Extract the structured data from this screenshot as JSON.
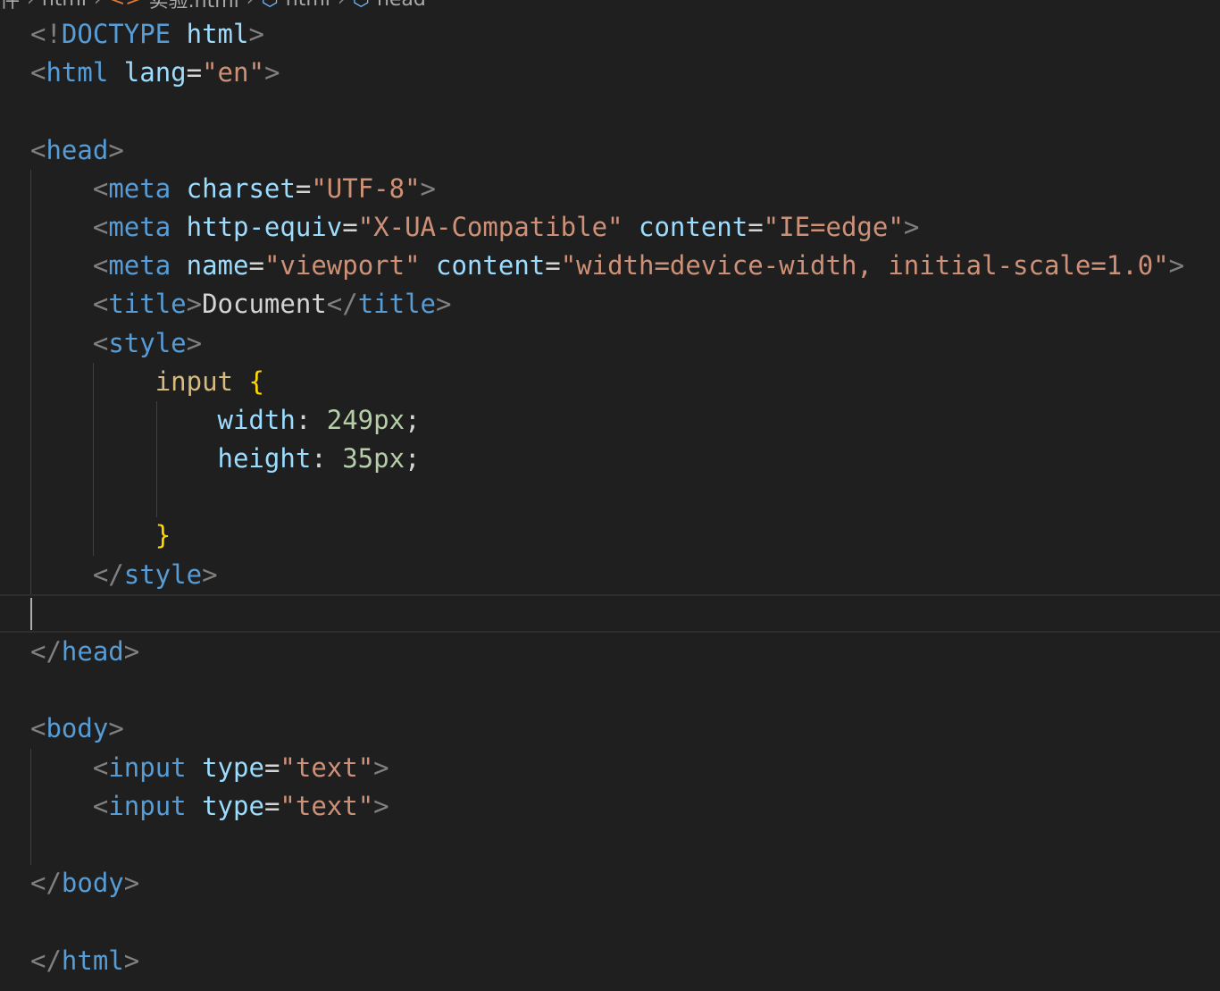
{
  "breadcrumb": [
    "件",
    "html",
    "实验.html",
    "html",
    "head"
  ],
  "editor": {
    "cursor_line": 15,
    "lines": [
      [
        [
          "punc",
          "<!"
        ],
        [
          "tag",
          "DOCTYPE"
        ],
        [
          "text",
          " "
        ],
        [
          "attr",
          "html"
        ],
        [
          "punc",
          ">"
        ]
      ],
      [
        [
          "punc",
          "<"
        ],
        [
          "tag",
          "html"
        ],
        [
          "text",
          " "
        ],
        [
          "attr",
          "lang"
        ],
        [
          "text",
          "="
        ],
        [
          "str",
          "\"en\""
        ],
        [
          "punc",
          ">"
        ]
      ],
      [],
      [
        [
          "punc",
          "<"
        ],
        [
          "tag",
          "head"
        ],
        [
          "punc",
          ">"
        ]
      ],
      [
        [
          "text",
          "    "
        ],
        [
          "punc",
          "<"
        ],
        [
          "tag",
          "meta"
        ],
        [
          "text",
          " "
        ],
        [
          "attr",
          "charset"
        ],
        [
          "text",
          "="
        ],
        [
          "str",
          "\"UTF-8\""
        ],
        [
          "punc",
          ">"
        ]
      ],
      [
        [
          "text",
          "    "
        ],
        [
          "punc",
          "<"
        ],
        [
          "tag",
          "meta"
        ],
        [
          "text",
          " "
        ],
        [
          "attr",
          "http-equiv"
        ],
        [
          "text",
          "="
        ],
        [
          "str",
          "\"X-UA-Compatible\""
        ],
        [
          "text",
          " "
        ],
        [
          "attr",
          "content"
        ],
        [
          "text",
          "="
        ],
        [
          "str",
          "\"IE=edge\""
        ],
        [
          "punc",
          ">"
        ]
      ],
      [
        [
          "text",
          "    "
        ],
        [
          "punc",
          "<"
        ],
        [
          "tag",
          "meta"
        ],
        [
          "text",
          " "
        ],
        [
          "attr",
          "name"
        ],
        [
          "text",
          "="
        ],
        [
          "str",
          "\"viewport\""
        ],
        [
          "text",
          " "
        ],
        [
          "attr",
          "content"
        ],
        [
          "text",
          "="
        ],
        [
          "str",
          "\"width=device-width, initial-scale=1.0\""
        ],
        [
          "punc",
          ">"
        ]
      ],
      [
        [
          "text",
          "    "
        ],
        [
          "punc",
          "<"
        ],
        [
          "tag",
          "title"
        ],
        [
          "punc",
          ">"
        ],
        [
          "text",
          "Document"
        ],
        [
          "punc",
          "</"
        ],
        [
          "tag",
          "title"
        ],
        [
          "punc",
          ">"
        ]
      ],
      [
        [
          "text",
          "    "
        ],
        [
          "punc",
          "<"
        ],
        [
          "tag",
          "style"
        ],
        [
          "punc",
          ">"
        ]
      ],
      [
        [
          "text",
          "        "
        ],
        [
          "sel",
          "input"
        ],
        [
          "text",
          " "
        ],
        [
          "brace",
          "{"
        ]
      ],
      [
        [
          "text",
          "            "
        ],
        [
          "prop",
          "width"
        ],
        [
          "text",
          ": "
        ],
        [
          "num",
          "249px"
        ],
        [
          "text",
          ";"
        ]
      ],
      [
        [
          "text",
          "            "
        ],
        [
          "prop",
          "height"
        ],
        [
          "text",
          ": "
        ],
        [
          "num",
          "35px"
        ],
        [
          "text",
          ";"
        ]
      ],
      [],
      [
        [
          "text",
          "        "
        ],
        [
          "brace",
          "}"
        ]
      ],
      [
        [
          "text",
          "    "
        ],
        [
          "punc",
          "</"
        ],
        [
          "tag",
          "style"
        ],
        [
          "punc",
          ">"
        ]
      ],
      [],
      [
        [
          "punc",
          "</"
        ],
        [
          "tag",
          "head"
        ],
        [
          "punc",
          ">"
        ]
      ],
      [],
      [
        [
          "punc",
          "<"
        ],
        [
          "tag",
          "body"
        ],
        [
          "punc",
          ">"
        ]
      ],
      [
        [
          "text",
          "    "
        ],
        [
          "punc",
          "<"
        ],
        [
          "tag",
          "input"
        ],
        [
          "text",
          " "
        ],
        [
          "attr",
          "type"
        ],
        [
          "text",
          "="
        ],
        [
          "str",
          "\"text\""
        ],
        [
          "punc",
          ">"
        ]
      ],
      [
        [
          "text",
          "    "
        ],
        [
          "punc",
          "<"
        ],
        [
          "tag",
          "input"
        ],
        [
          "text",
          " "
        ],
        [
          "attr",
          "type"
        ],
        [
          "text",
          "="
        ],
        [
          "str",
          "\"text\""
        ],
        [
          "punc",
          ">"
        ]
      ],
      [],
      [
        [
          "punc",
          "</"
        ],
        [
          "tag",
          "body"
        ],
        [
          "punc",
          ">"
        ]
      ],
      [],
      [
        [
          "punc",
          "</"
        ],
        [
          "tag",
          "html"
        ],
        [
          "punc",
          ">"
        ]
      ]
    ]
  }
}
